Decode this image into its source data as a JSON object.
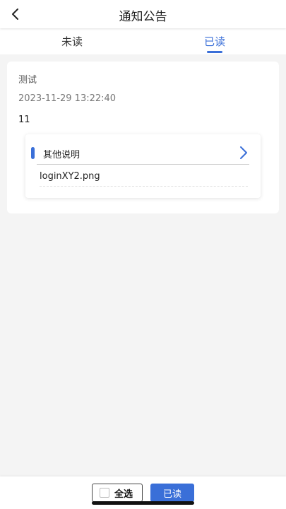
{
  "header": {
    "title": "通知公告",
    "back_icon": "chevron-left-icon"
  },
  "tabs": [
    {
      "label": "未读",
      "active": false
    },
    {
      "label": "已读",
      "active": true
    }
  ],
  "notice": {
    "title": "测试",
    "time": "2023-11-29 13:22:40",
    "content": "11",
    "attachments": {
      "heading": "其他说明",
      "arrow_icon": "chevron-right-icon",
      "file_name": "loginXY2.png"
    }
  },
  "footer": {
    "select_all_label": "全选",
    "select_all_checked": false,
    "mark_read_label": "已读"
  },
  "colors": {
    "accent": "#3a6fd8",
    "background": "#f4f4f4",
    "card": "#ffffff"
  }
}
